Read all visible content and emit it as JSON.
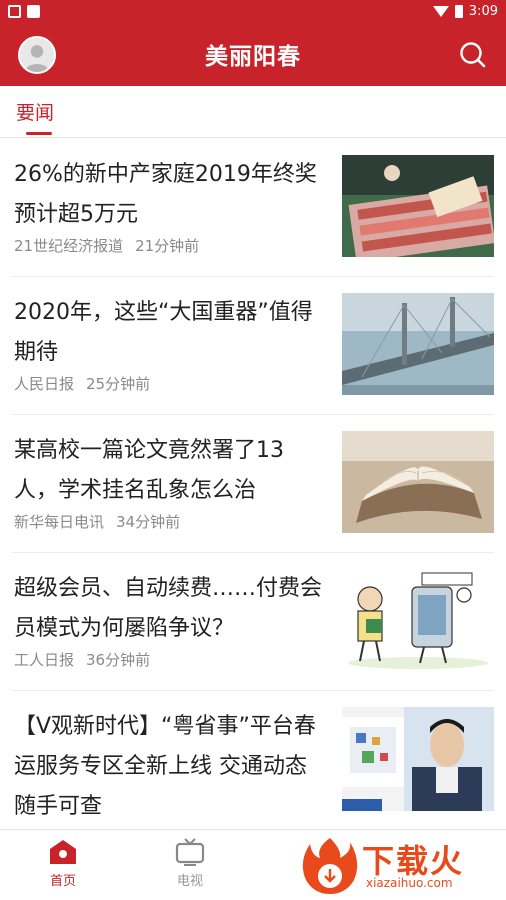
{
  "status_bar": {
    "time": "3:09"
  },
  "header": {
    "title": "美丽阳春"
  },
  "tabs": [
    {
      "label": "要闻",
      "active": true
    }
  ],
  "news": [
    {
      "title": "26%的新中产家庭2019年终奖预计超5万元",
      "source": "21世纪经济报道",
      "time": "21分钟前"
    },
    {
      "title": "2020年，这些“大国重器”值得期待",
      "source": "人民日报",
      "time": "25分钟前"
    },
    {
      "title": "某高校一篇论文竟然署了13人，学术挂名乱象怎么治",
      "source": "新华每日电讯",
      "time": "34分钟前"
    },
    {
      "title": "超级会员、自动续费……付费会员模式为何屡陷争议？",
      "source": "工人日报",
      "time": "36分钟前"
    },
    {
      "title": "【V观新时代】“粤省事”平台春运服务专区全新上线 交通动态随手可查",
      "source": "",
      "time": ""
    }
  ],
  "bottom_nav": [
    {
      "label": "首页",
      "active": true
    },
    {
      "label": "电视",
      "active": false
    }
  ],
  "watermark": {
    "brand": "下载火",
    "url": "xiazaihuo.com"
  },
  "colors": {
    "brand_red": "#c8232a",
    "watermark_orange": "#e84a1b"
  }
}
